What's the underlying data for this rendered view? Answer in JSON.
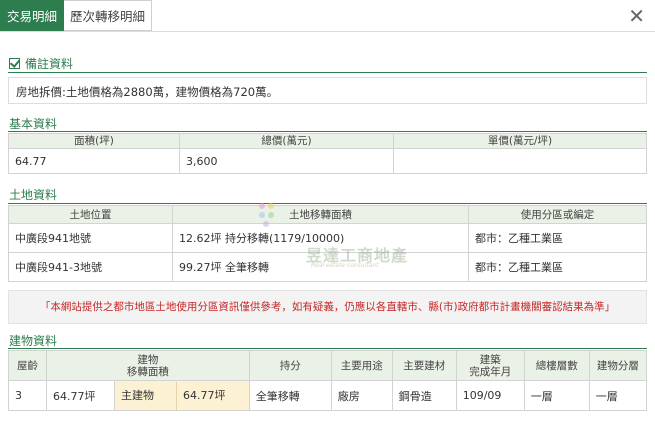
{
  "tabs": [
    {
      "label": "交易明細",
      "active": true
    },
    {
      "label": "歷次轉移明細",
      "active": false
    }
  ],
  "close_label": "✕",
  "remarks": {
    "title": "備註資料",
    "text": "房地拆價:土地價格為2880萬，建物價格為720萬。"
  },
  "basic": {
    "title": "基本資料",
    "headers": [
      "面積(坪)",
      "總價(萬元)",
      "單價(萬元/坪)"
    ],
    "row": [
      "64.77",
      "3,600",
      ""
    ]
  },
  "land": {
    "title": "土地資料",
    "headers": [
      "土地位置",
      "土地移轉面積",
      "使用分區或編定"
    ],
    "rows": [
      [
        "中廣段941地號",
        "12.62坪 持分移轉(1179/10000)",
        "都市：乙種工業區"
      ],
      [
        "中廣段941-3地號",
        "99.27坪 全筆移轉",
        "都市：乙種工業區"
      ]
    ]
  },
  "disclaimer": "「本網站提供之都市地區土地使用分區資訊僅供參考，如有疑義，仍應以各直轄市、縣(市)政府都市計畫機關審認結果為準」",
  "building": {
    "title": "建物資料",
    "headers": [
      "屋齡",
      "建物移轉面積",
      "持分",
      "主要用途",
      "主要建材",
      "建築完成年月",
      "總樓層數",
      "建物分層"
    ],
    "header_lines": {
      "area": [
        "建物",
        "移轉面積"
      ],
      "completed": [
        "建築",
        "完成年月"
      ]
    },
    "row": {
      "age": "3",
      "area_total": "64.77坪",
      "main_label": "主建物",
      "main_area": "64.77坪",
      "share": "全筆移轉",
      "use": "廠房",
      "material": "鋼骨造",
      "completed": "109/09",
      "floors": "一層",
      "layer": "一層"
    }
  },
  "watermark": {
    "text": "昱達工商地產",
    "sub": "Real estate consultant"
  },
  "colors": {
    "accent": "#2e7d4f",
    "header_bg": "#eaf1e6",
    "highlight": "#fdf1d3",
    "warning": "#c62828"
  }
}
